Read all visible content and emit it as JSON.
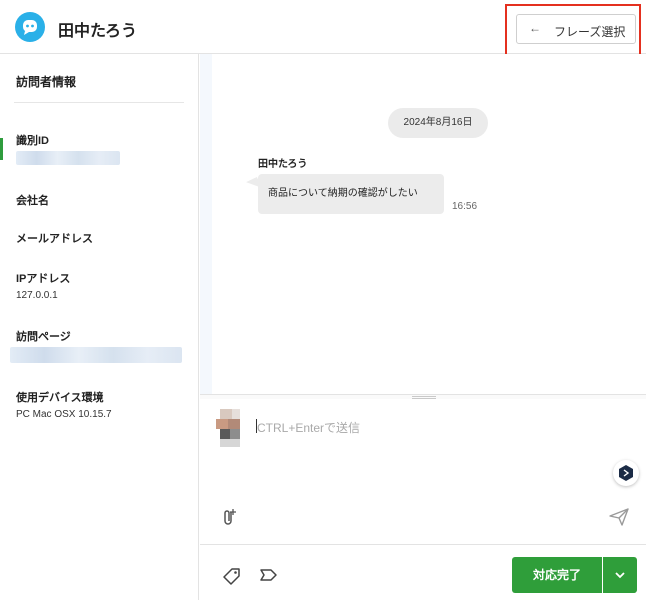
{
  "header": {
    "title": "田中たろう",
    "phrase_button_label": "フレーズ選択",
    "phrase_button_arrow": "←"
  },
  "sidebar": {
    "title": "訪問者情報",
    "fields": [
      {
        "label": "識別ID",
        "value": ""
      },
      {
        "label": "会社名",
        "value": ""
      },
      {
        "label": "メールアドレス",
        "value": ""
      },
      {
        "label": "IPアドレス",
        "value": "127.0.0.1"
      },
      {
        "label": "訪問ページ",
        "value": ""
      },
      {
        "label": "使用デバイス環境",
        "value": "PC Mac OSX 10.15.7"
      }
    ]
  },
  "chat": {
    "date": "2024年8月16日",
    "messages": [
      {
        "sender": "田中たろう",
        "text": "商品について納期の確認がしたい",
        "time": "16:56"
      }
    ]
  },
  "composer": {
    "placeholder": "CTRL+Enterで送信"
  },
  "footer": {
    "done_label": "対応完了"
  },
  "colors": {
    "brand": "#2ab0e8",
    "highlight": "#e4301f",
    "done_button": "#2f9e3a"
  },
  "icons": [
    "chat-logo-icon",
    "arrow-left-icon",
    "deepl-icon",
    "paperclip-icon",
    "send-icon",
    "tag-icon",
    "label-icon",
    "chevron-down-icon"
  ]
}
